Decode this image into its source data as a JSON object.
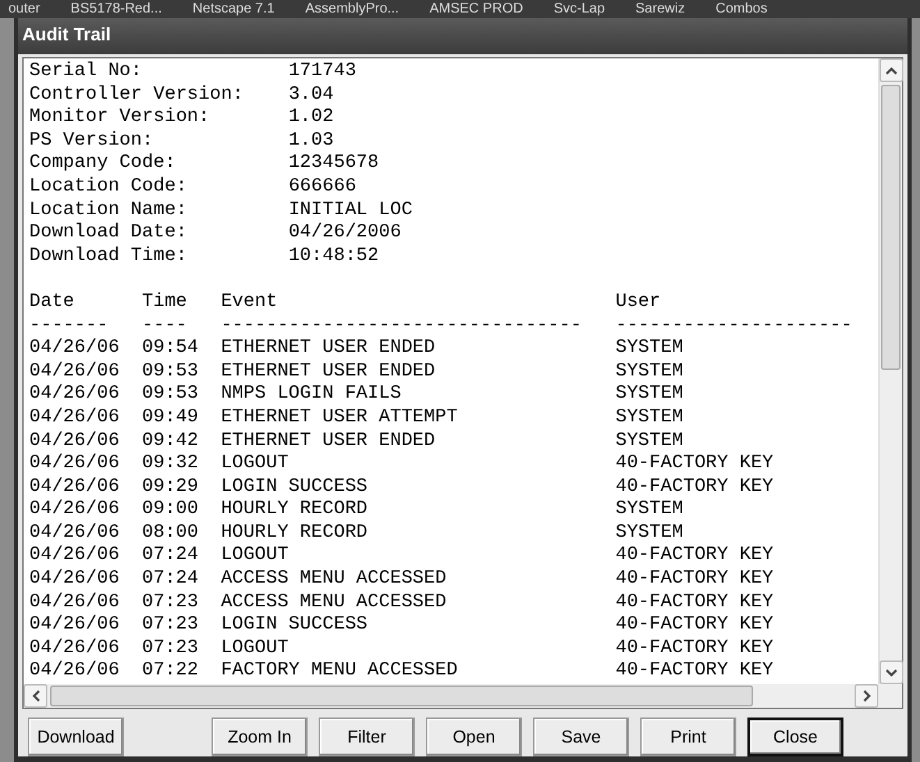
{
  "background_windows": [
    "outer",
    "BS5178-Red...",
    "Netscape 7.1",
    "AssemblyPro...",
    "AMSEC PROD",
    "Svc-Lap",
    "Sarewiz",
    "Combos"
  ],
  "window": {
    "title": "Audit Trail"
  },
  "info": [
    {
      "label": "Serial No:",
      "value": "171743"
    },
    {
      "label": "Controller Version:",
      "value": "3.04"
    },
    {
      "label": "Monitor Version:",
      "value": "1.02"
    },
    {
      "label": "PS Version:",
      "value": "1.03"
    },
    {
      "label": "Company Code:",
      "value": "12345678"
    },
    {
      "label": "Location Code:",
      "value": "666666"
    },
    {
      "label": "Location Name:",
      "value": "INITIAL LOC"
    },
    {
      "label": "Download Date:",
      "value": "04/26/2006"
    },
    {
      "label": "Download Time:",
      "value": "10:48:52"
    }
  ],
  "log": {
    "columns": [
      "Date",
      "Time",
      "Event",
      "User"
    ],
    "separators": [
      "-------",
      "----",
      "--------------------------------",
      "---------------------"
    ],
    "rows": [
      [
        "04/26/06",
        "09:54",
        "ETHERNET USER ENDED",
        "SYSTEM"
      ],
      [
        "04/26/06",
        "09:53",
        "ETHERNET USER ENDED",
        "SYSTEM"
      ],
      [
        "04/26/06",
        "09:53",
        "NMPS LOGIN FAILS",
        "SYSTEM"
      ],
      [
        "04/26/06",
        "09:49",
        "ETHERNET USER ATTEMPT",
        "SYSTEM"
      ],
      [
        "04/26/06",
        "09:42",
        "ETHERNET USER ENDED",
        "SYSTEM"
      ],
      [
        "04/26/06",
        "09:32",
        "LOGOUT",
        "40-FACTORY KEY"
      ],
      [
        "04/26/06",
        "09:29",
        "LOGIN SUCCESS",
        "40-FACTORY KEY"
      ],
      [
        "04/26/06",
        "09:00",
        "HOURLY RECORD",
        "SYSTEM"
      ],
      [
        "04/26/06",
        "08:00",
        "HOURLY RECORD",
        "SYSTEM"
      ],
      [
        "04/26/06",
        "07:24",
        "LOGOUT",
        "40-FACTORY KEY"
      ],
      [
        "04/26/06",
        "07:24",
        "ACCESS MENU ACCESSED",
        "40-FACTORY KEY"
      ],
      [
        "04/26/06",
        "07:23",
        "ACCESS MENU ACCESSED",
        "40-FACTORY KEY"
      ],
      [
        "04/26/06",
        "07:23",
        "LOGIN SUCCESS",
        "40-FACTORY KEY"
      ],
      [
        "04/26/06",
        "07:23",
        "LOGOUT",
        "40-FACTORY KEY"
      ],
      [
        "04/26/06",
        "07:22",
        "FACTORY MENU ACCESSED",
        "40-FACTORY KEY"
      ]
    ]
  },
  "buttons": [
    {
      "label": "Download",
      "default": false
    },
    {
      "label": "Zoom In",
      "default": false
    },
    {
      "label": "Filter",
      "default": false
    },
    {
      "label": "Open",
      "default": false
    },
    {
      "label": "Save",
      "default": false
    },
    {
      "label": "Print",
      "default": false
    },
    {
      "label": "Close",
      "default": true
    }
  ]
}
